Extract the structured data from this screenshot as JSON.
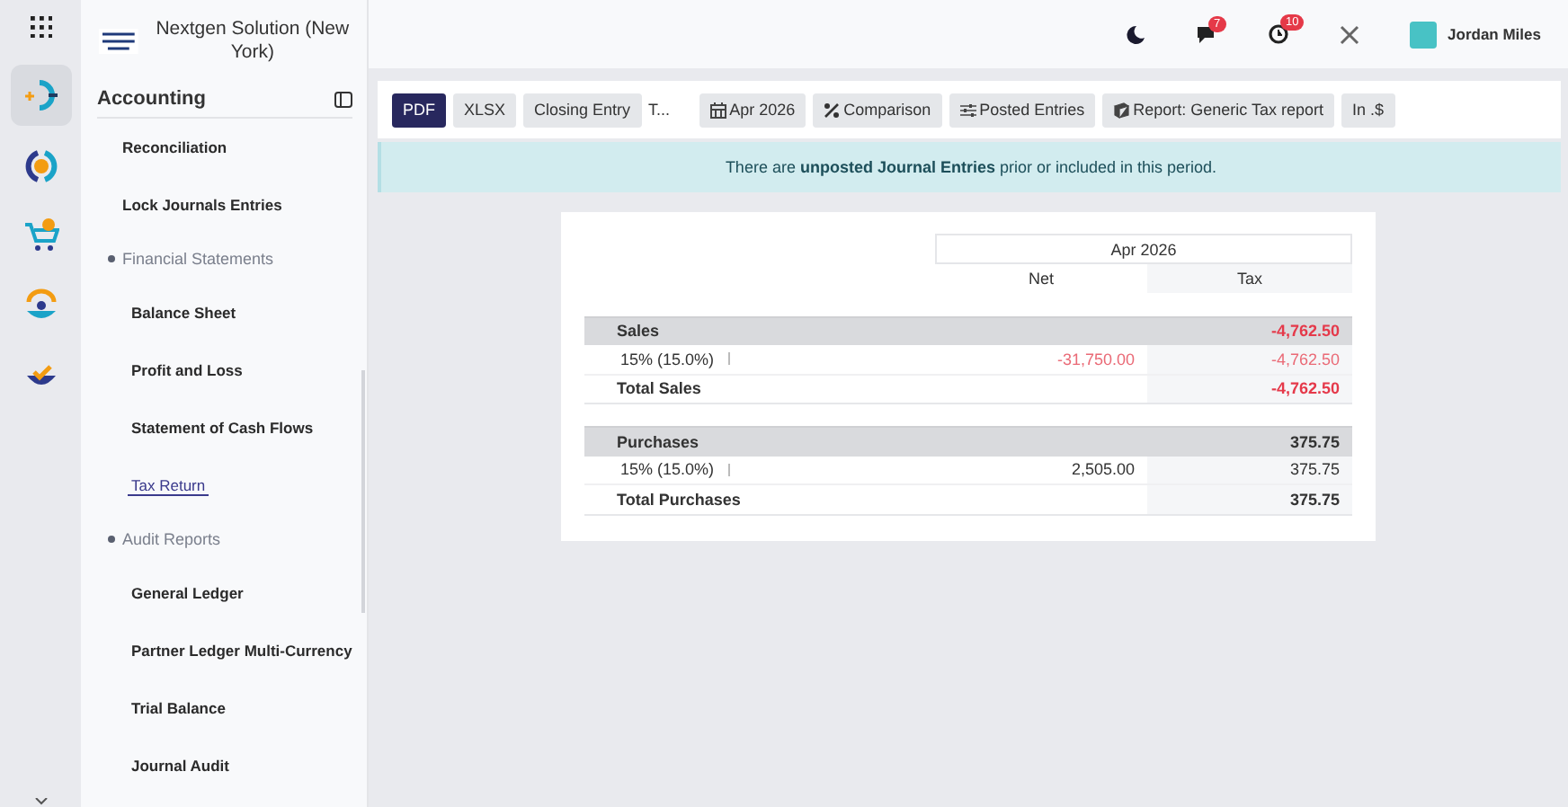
{
  "rail": {
    "apps": [
      {
        "kind": "accounting",
        "selected": true
      },
      {
        "kind": "finance",
        "selected": false
      },
      {
        "kind": "sales",
        "selected": false
      },
      {
        "kind": "contacts",
        "selected": false
      },
      {
        "kind": "approvals",
        "selected": false
      }
    ]
  },
  "sidebar": {
    "company": "Nextgen Solution (New York)",
    "title": "Accounting",
    "items": [
      {
        "kind": "item",
        "label": "Reconciliation",
        "selected": false
      },
      {
        "kind": "item",
        "label": "Lock Journals Entries",
        "selected": false
      },
      {
        "kind": "section",
        "label": "Financial Statements",
        "children": [
          {
            "label": "Balance Sheet",
            "selected": false
          },
          {
            "label": "Profit and Loss",
            "selected": false
          },
          {
            "label": "Statement of Cash Flows",
            "selected": false
          },
          {
            "label": "Tax Return",
            "selected": true
          }
        ]
      },
      {
        "kind": "section",
        "label": "Audit Reports",
        "children": [
          {
            "label": "General Ledger",
            "selected": false
          },
          {
            "label": "Partner Ledger Multi-Currency",
            "selected": false
          },
          {
            "label": "Trial Balance",
            "selected": false
          },
          {
            "label": "Journal Audit",
            "selected": false
          }
        ]
      }
    ]
  },
  "topbar": {
    "chat_badge": "7",
    "activity_badge": "10",
    "user": "Jordan Miles"
  },
  "toolbar": [
    {
      "kind": "export",
      "label": "PDF",
      "primary": true
    },
    {
      "kind": "export",
      "label": "XLSX",
      "primary": false
    },
    {
      "kind": "action",
      "label": "Closing Entry",
      "primary": false
    },
    {
      "kind": "text",
      "label": "T..."
    },
    {
      "kind": "date",
      "label": "Apr 2026",
      "primary": false
    },
    {
      "kind": "comparison",
      "label": "Comparison",
      "primary": false
    },
    {
      "kind": "filter",
      "label": "Posted Entries",
      "primary": false
    },
    {
      "kind": "report",
      "label": "Report: Generic Tax report",
      "primary": false
    },
    {
      "kind": "currency",
      "label": "In .$",
      "primary": false
    }
  ],
  "alert": "There are **unposted Journal Entries** prior or included in this period.",
  "report": {
    "period": "Apr 2026",
    "columns": [
      "Net",
      "Tax"
    ],
    "rows": [
      {
        "kind": "section",
        "label": "Sales",
        "net": "",
        "tax": "-4,762.50",
        "negative": true
      },
      {
        "kind": "line",
        "label": "15% (15.0%)",
        "net": "-31,750.00",
        "tax": "-4,762.50",
        "negative": true
      },
      {
        "kind": "total",
        "label": "Total Sales",
        "net": "",
        "tax": "-4,762.50",
        "negative": true
      },
      {
        "kind": "gap"
      },
      {
        "kind": "section",
        "label": "Purchases",
        "net": "",
        "tax": "375.75",
        "negative": false
      },
      {
        "kind": "line",
        "label": "15% (15.0%)",
        "net": "2,505.00",
        "tax": "375.75",
        "negative": false
      },
      {
        "kind": "total",
        "label": "Total Purchases",
        "net": "",
        "tax": "375.75",
        "negative": false
      }
    ]
  }
}
